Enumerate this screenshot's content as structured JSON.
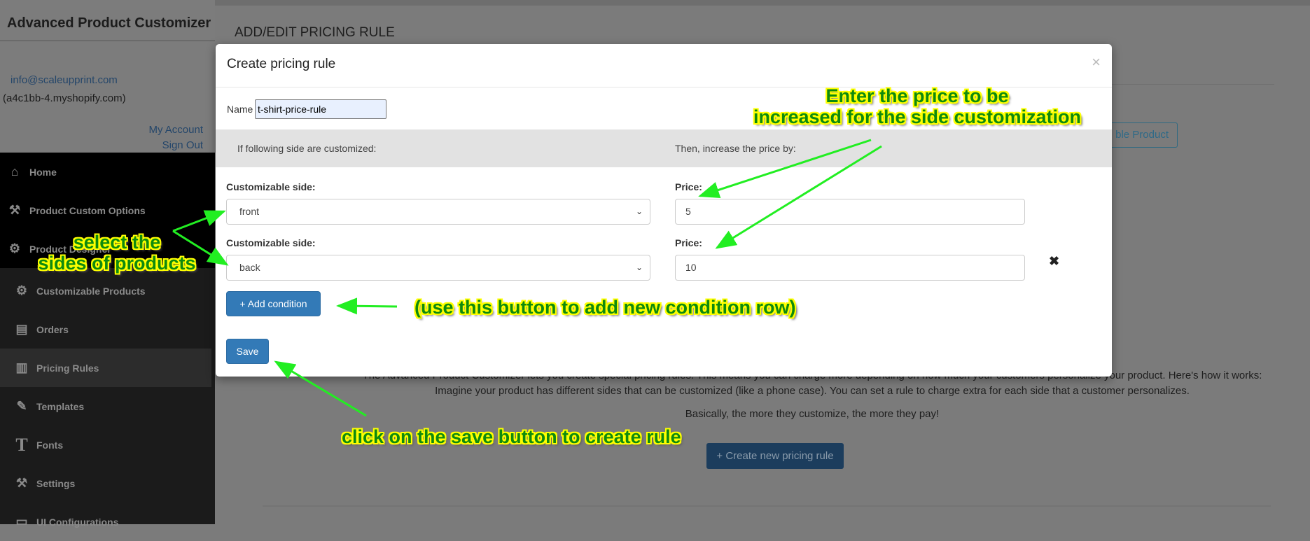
{
  "sidebar": {
    "app_title": "Advanced Product Customizer",
    "email": "info@scaleupprint.com",
    "shop": "(a4c1bb-4.myshopify.com)",
    "my_account": "My Account",
    "sign_out": "Sign Out",
    "items": [
      {
        "label": "Home",
        "icon": "home-icon"
      },
      {
        "label": "Product Custom Options",
        "icon": "tools-icon"
      },
      {
        "label": "Product Designer",
        "icon": "network-icon"
      },
      {
        "label": "Customizable Products",
        "icon": "network-icon"
      },
      {
        "label": "Orders",
        "icon": "orders-icon"
      },
      {
        "label": "Pricing Rules",
        "icon": "clipboard-icon",
        "active": true
      },
      {
        "label": "Templates",
        "icon": "edit-icon"
      },
      {
        "label": "Fonts",
        "icon": "font-icon"
      },
      {
        "label": "Settings",
        "icon": "tools-icon"
      },
      {
        "label": "UI Configurations",
        "icon": "ui-icon"
      }
    ]
  },
  "page": {
    "title": "ADD/EDIT PRICING RULE",
    "bg_button": "Add Customizable Product",
    "bg_button_visible": "ble Product",
    "desc_line1": "The Advanced Product Customizer lets you create special pricing rules. This means you can charge more depending on how much your customers personalize your product. Here's how it works:",
    "desc_line2": "Imagine your product has different sides that can be customized (like a phone case). You can set a rule to charge extra for each side that a customer personalizes.",
    "desc_line3": "Basically, the more they customize, the more they pay!",
    "create_button": "+ Create new pricing rule"
  },
  "modal": {
    "title": "Create pricing rule",
    "close": "×",
    "name_label": "Name",
    "name_value": "t-shirt-price-rule",
    "band_left": "If following side are customized:",
    "band_right": "Then, increase the price by:",
    "rows": [
      {
        "side_label": "Customizable side:",
        "side_value": "front",
        "price_label": "Price:",
        "price_value": "5"
      },
      {
        "side_label": "Customizable side:",
        "side_value": "back",
        "price_label": "Price:",
        "price_value": "10"
      }
    ],
    "remove_icon": "✖",
    "add_condition": "+ Add condition",
    "save": "Save"
  },
  "annotations": {
    "price_line1": "Enter the price to be",
    "price_line2": "increased for the side customization",
    "sides_line1": "select the",
    "sides_line2": "sides of products",
    "add_row": "(use this button to add new condition row)",
    "save_hint": "click on the save button to create rule"
  },
  "colors": {
    "primary": "#337ab7",
    "annotation_text": "#0e8a0e",
    "annotation_outline": "#ffff00",
    "arrow": "#22ee22"
  }
}
